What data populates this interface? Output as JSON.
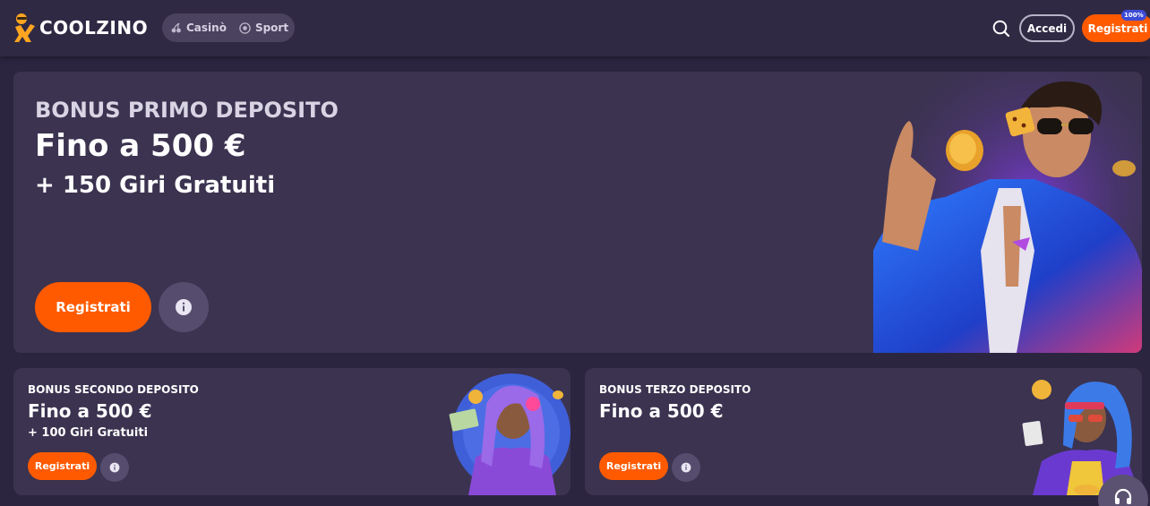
{
  "header": {
    "logo_text": "COOLZINO",
    "nav": [
      {
        "label": "Casinò",
        "icon": "cherry-icon"
      },
      {
        "label": "Sport",
        "icon": "soccer-ball-icon"
      }
    ],
    "login_label": "Accedi",
    "register_label": "Registrati",
    "register_badge": "100%"
  },
  "hero": {
    "kicker": "BONUS PRIMO DEPOSITO",
    "title": "Fino a 500 €",
    "subtitle": "+ 150 Giri Gratuiti",
    "cta_label": "Registrati"
  },
  "cards": [
    {
      "kicker": "BONUS SECONDO DEPOSITO",
      "title": "Fino a 500 €",
      "subtitle": "+ 100 Giri Gratuiti",
      "cta_label": "Registrati"
    },
    {
      "kicker": "BONUS TERZO DEPOSITO",
      "title": "Fino a 500 €",
      "cta_label": "Registrati"
    }
  ],
  "colors": {
    "accent": "#ff5a00",
    "background": "#2b2540",
    "card": "#3b3350"
  }
}
